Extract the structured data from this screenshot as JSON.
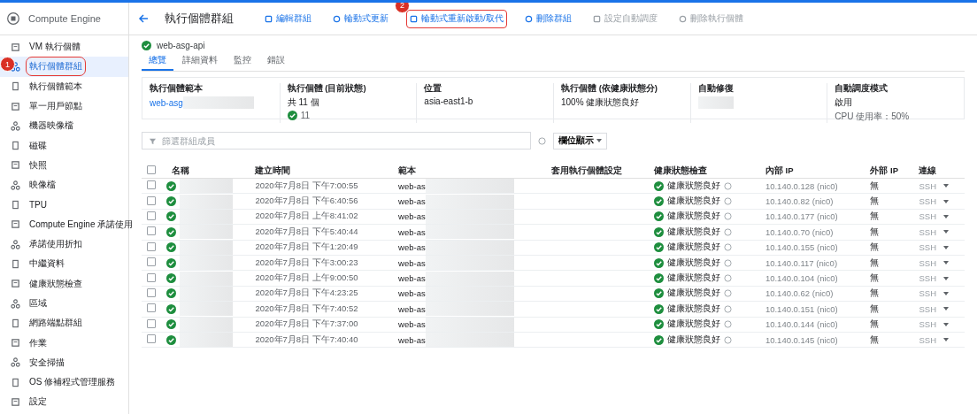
{
  "app": {
    "title": "Compute Engine"
  },
  "sidebar": {
    "items": [
      {
        "label": "VM 執行個體",
        "selected": false
      },
      {
        "label": "執行個體群組",
        "selected": true,
        "badge": "1"
      },
      {
        "label": "執行個體範本",
        "selected": false
      },
      {
        "label": "單一用戶節點",
        "selected": false
      },
      {
        "label": "機器映像檔",
        "selected": false
      },
      {
        "label": "磁碟",
        "selected": false
      },
      {
        "label": "快照",
        "selected": false
      },
      {
        "label": "映像檔",
        "selected": false
      },
      {
        "label": "TPU",
        "selected": false
      },
      {
        "label": "Compute Engine 承諾使用",
        "selected": false
      },
      {
        "label": "承諾使用折扣",
        "selected": false
      },
      {
        "label": "中繼資料",
        "selected": false
      },
      {
        "label": "健康狀態檢查",
        "selected": false
      },
      {
        "label": "區域",
        "selected": false
      },
      {
        "label": "網路端點群組",
        "selected": false
      },
      {
        "label": "作業",
        "selected": false
      },
      {
        "label": "安全掃描",
        "selected": false
      },
      {
        "label": "OS 修補程式管理服務",
        "selected": false
      },
      {
        "label": "設定",
        "selected": false
      }
    ]
  },
  "toolbar": {
    "title": "執行個體群組",
    "buttons": [
      {
        "label": "編輯群組",
        "disabled": false,
        "highlighted": false
      },
      {
        "label": "輪動式更新",
        "disabled": false,
        "highlighted": false
      },
      {
        "label": "輪動式重新啟動/取代",
        "disabled": false,
        "highlighted": true,
        "badge": "2"
      },
      {
        "label": "刪除群組",
        "disabled": false,
        "highlighted": false
      },
      {
        "label": "設定自動調度",
        "disabled": true,
        "highlighted": false
      },
      {
        "label": "刪除執行個體",
        "disabled": true,
        "highlighted": false
      }
    ]
  },
  "group": {
    "name": "web-asg-api",
    "tabs": [
      {
        "label": "總覽",
        "selected": true
      },
      {
        "label": "詳細資料",
        "selected": false
      },
      {
        "label": "監控",
        "selected": false
      },
      {
        "label": "錯誤",
        "selected": false
      }
    ]
  },
  "summary": [
    {
      "label": "執行個體範本",
      "kind": "link",
      "value": "web-asg"
    },
    {
      "label": "執行個體 (目前狀態)",
      "kind": "count",
      "value": "共 11 個",
      "ok": "11"
    },
    {
      "label": "位置",
      "kind": "text",
      "value": "asia-east1-b"
    },
    {
      "label": "執行個體 (依健康狀態分)",
      "kind": "text",
      "value": "100% 健康狀態良好"
    },
    {
      "label": "自動修復",
      "kind": "redacted"
    },
    {
      "label": "自動調度模式",
      "kind": "note",
      "value": "啟用",
      "note": "CPU 使用率：50%"
    }
  ],
  "filter": {
    "placeholder": "篩選群組成員",
    "columns_button": "欄位顯示"
  },
  "table": {
    "all_checked": false,
    "columns": [
      "名稱",
      "建立時間",
      "範本",
      "套用執行個體設定",
      "健康狀態檢查",
      "內部 IP",
      "外部 IP",
      "連線"
    ],
    "rows": [
      {
        "checked": false,
        "created": "2020年7月8日 下午7:00:55",
        "template": "web-as",
        "health": "健康狀態良好",
        "internal_ip": "10.140.0.128 (nic0)",
        "external_ip": "無",
        "connect": "SSH"
      },
      {
        "checked": false,
        "created": "2020年7月8日 下午6:40:56",
        "template": "web-as",
        "health": "健康狀態良好",
        "internal_ip": "10.140.0.82 (nic0)",
        "external_ip": "無",
        "connect": "SSH"
      },
      {
        "checked": false,
        "created": "2020年7月8日 上午8:41:02",
        "template": "web-as",
        "health": "健康狀態良好",
        "internal_ip": "10.140.0.177 (nic0)",
        "external_ip": "無",
        "connect": "SSH"
      },
      {
        "checked": false,
        "created": "2020年7月8日 下午5:40:44",
        "template": "web-as",
        "health": "健康狀態良好",
        "internal_ip": "10.140.0.70 (nic0)",
        "external_ip": "無",
        "connect": "SSH"
      },
      {
        "checked": false,
        "created": "2020年7月8日 下午1:20:49",
        "template": "web-as",
        "health": "健康狀態良好",
        "internal_ip": "10.140.0.155 (nic0)",
        "external_ip": "無",
        "connect": "SSH"
      },
      {
        "checked": false,
        "created": "2020年7月8日 下午3:00:23",
        "template": "web-as",
        "health": "健康狀態良好",
        "internal_ip": "10.140.0.117 (nic0)",
        "external_ip": "無",
        "connect": "SSH"
      },
      {
        "checked": false,
        "created": "2020年7月8日 上午9:00:50",
        "template": "web-as",
        "health": "健康狀態良好",
        "internal_ip": "10.140.0.104 (nic0)",
        "external_ip": "無",
        "connect": "SSH"
      },
      {
        "checked": false,
        "created": "2020年7月8日 下午4:23:25",
        "template": "web-as",
        "health": "健康狀態良好",
        "internal_ip": "10.140.0.62 (nic0)",
        "external_ip": "無",
        "connect": "SSH"
      },
      {
        "checked": false,
        "created": "2020年7月8日 下午7:40:52",
        "template": "web-as",
        "health": "健康狀態良好",
        "internal_ip": "10.140.0.151 (nic0)",
        "external_ip": "無",
        "connect": "SSH"
      },
      {
        "checked": false,
        "created": "2020年7月8日 下午7:37:00",
        "template": "web-as",
        "health": "健康狀態良好",
        "internal_ip": "10.140.0.144 (nic0)",
        "external_ip": "無",
        "connect": "SSH"
      },
      {
        "checked": false,
        "created": "2020年7月8日 下午7:40:40",
        "template": "web-as",
        "health": "健康狀態良好",
        "internal_ip": "10.140.0.145 (nic0)",
        "external_ip": "無",
        "connect": "SSH"
      }
    ]
  }
}
